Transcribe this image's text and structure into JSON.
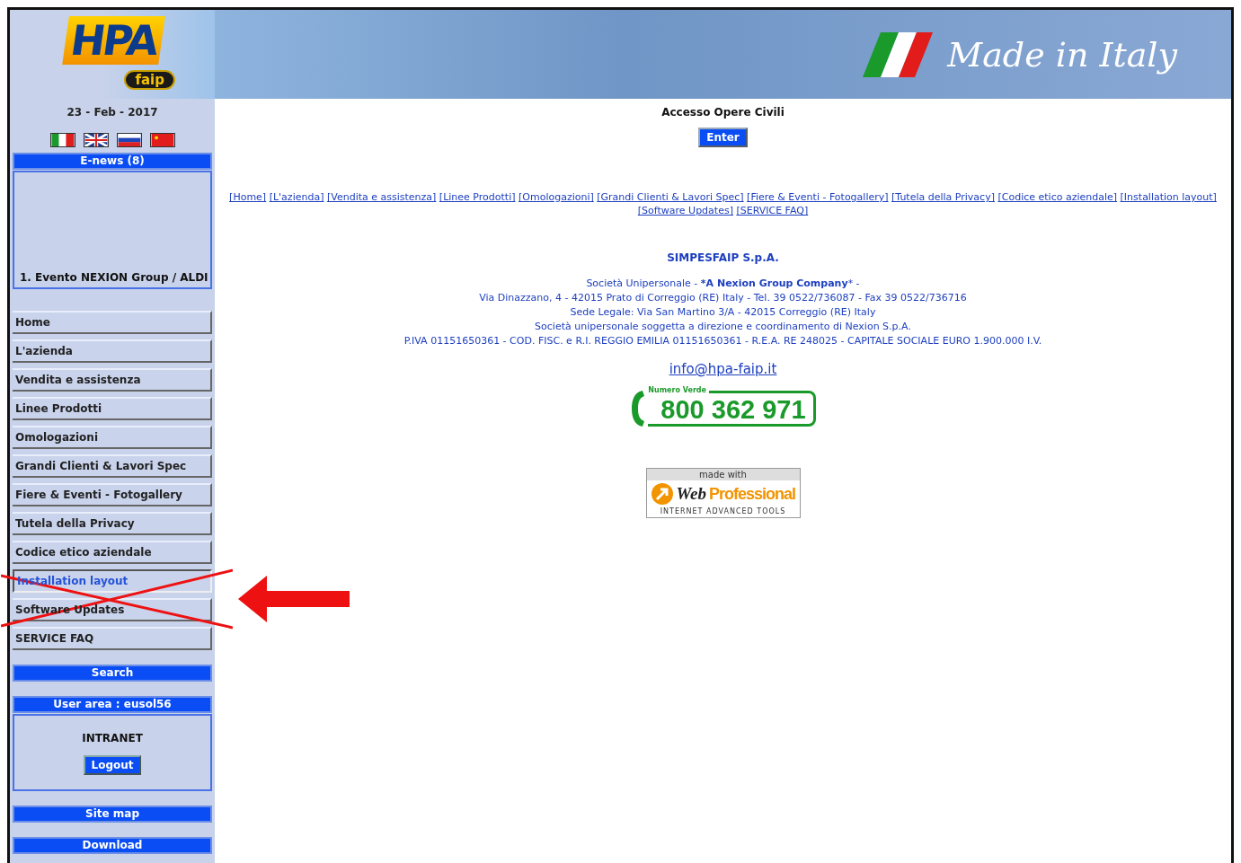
{
  "header": {
    "logo": {
      "main": "HPA",
      "sub": "faip"
    },
    "slogan": "Made in Italy"
  },
  "sidebar": {
    "date": "23 - Feb - 2017",
    "flags": [
      {
        "kind": "italy"
      },
      {
        "kind": "uk"
      },
      {
        "kind": "russia"
      },
      {
        "kind": "china"
      }
    ],
    "enews": {
      "title": "E-news (8)",
      "ticker": "1. Evento NEXION Group / ALDI"
    },
    "menu": [
      {
        "label": "Home",
        "selected": false,
        "struck": false
      },
      {
        "label": "L'azienda",
        "selected": false,
        "struck": false
      },
      {
        "label": "Vendita e assistenza",
        "selected": false,
        "struck": false
      },
      {
        "label": "Linee Prodotti",
        "selected": false,
        "struck": false
      },
      {
        "label": "Omologazioni",
        "selected": false,
        "struck": false
      },
      {
        "label": "Grandi Clienti & Lavori Spec",
        "selected": false,
        "struck": false
      },
      {
        "label": "Fiere & Eventi - Fotogallery",
        "selected": false,
        "struck": false
      },
      {
        "label": "Tutela della Privacy",
        "selected": false,
        "struck": false
      },
      {
        "label": "Codice etico aziendale",
        "selected": false,
        "struck": false
      },
      {
        "label": "Installation layout",
        "selected": true,
        "struck": true
      },
      {
        "label": "Software Updates",
        "selected": false,
        "struck": true
      },
      {
        "label": "SERVICE FAQ",
        "selected": false,
        "struck": false
      }
    ],
    "search_button": "Search",
    "user_area": {
      "title": "User area : eusol56",
      "section": "INTRANET",
      "logout": "Logout"
    },
    "site_map_button": "Site map",
    "download_button": "Download"
  },
  "main": {
    "title": "Accesso Opere Civili",
    "enter_button": "Enter",
    "links": [
      "[Home]",
      "[L'azienda]",
      "[Vendita e assistenza]",
      "[Linee Prodotti]",
      "[Omologazioni]",
      "[Grandi Clienti & Lavori Spec]",
      "[Fiere & Eventi - Fotogallery]",
      "[Tutela della Privacy]",
      "[Codice etico aziendale]",
      "[Installation layout]",
      "[Software Updates]",
      "[SERVICE FAQ]"
    ],
    "company": "SIMPESFAIP S.p.A.",
    "address_lines": [
      "Società Unipersonale  - ***A Nexion Group Company*** -",
      "Via Dinazzano, 4 - 42015 Prato di Correggio (RE) Italy - Tel. 39 0522/736087 - Fax 39 0522/736716",
      "Sede Legale: Via San Martino 3/A - 42015 Correggio (RE) Italy",
      "Società unipersonale soggetta a direzione e coordinamento di Nexion S.p.A.",
      "P.IVA 01151650361 -  COD. FISC. e R.I. REGGIO EMILIA 01151650361 - R.E.A. RE 248025 - CAPITALE SOCIALE EURO 1.900.000 I.V."
    ],
    "email": "info@hpa-faip.it",
    "toll_free": {
      "label": "Numero Verde",
      "number": "800 362 971"
    },
    "badge": {
      "top": "made with",
      "brand_a": "Web",
      "brand_b": "Professional",
      "tagline": "INTERNET ADVANCED TOOLS"
    }
  }
}
